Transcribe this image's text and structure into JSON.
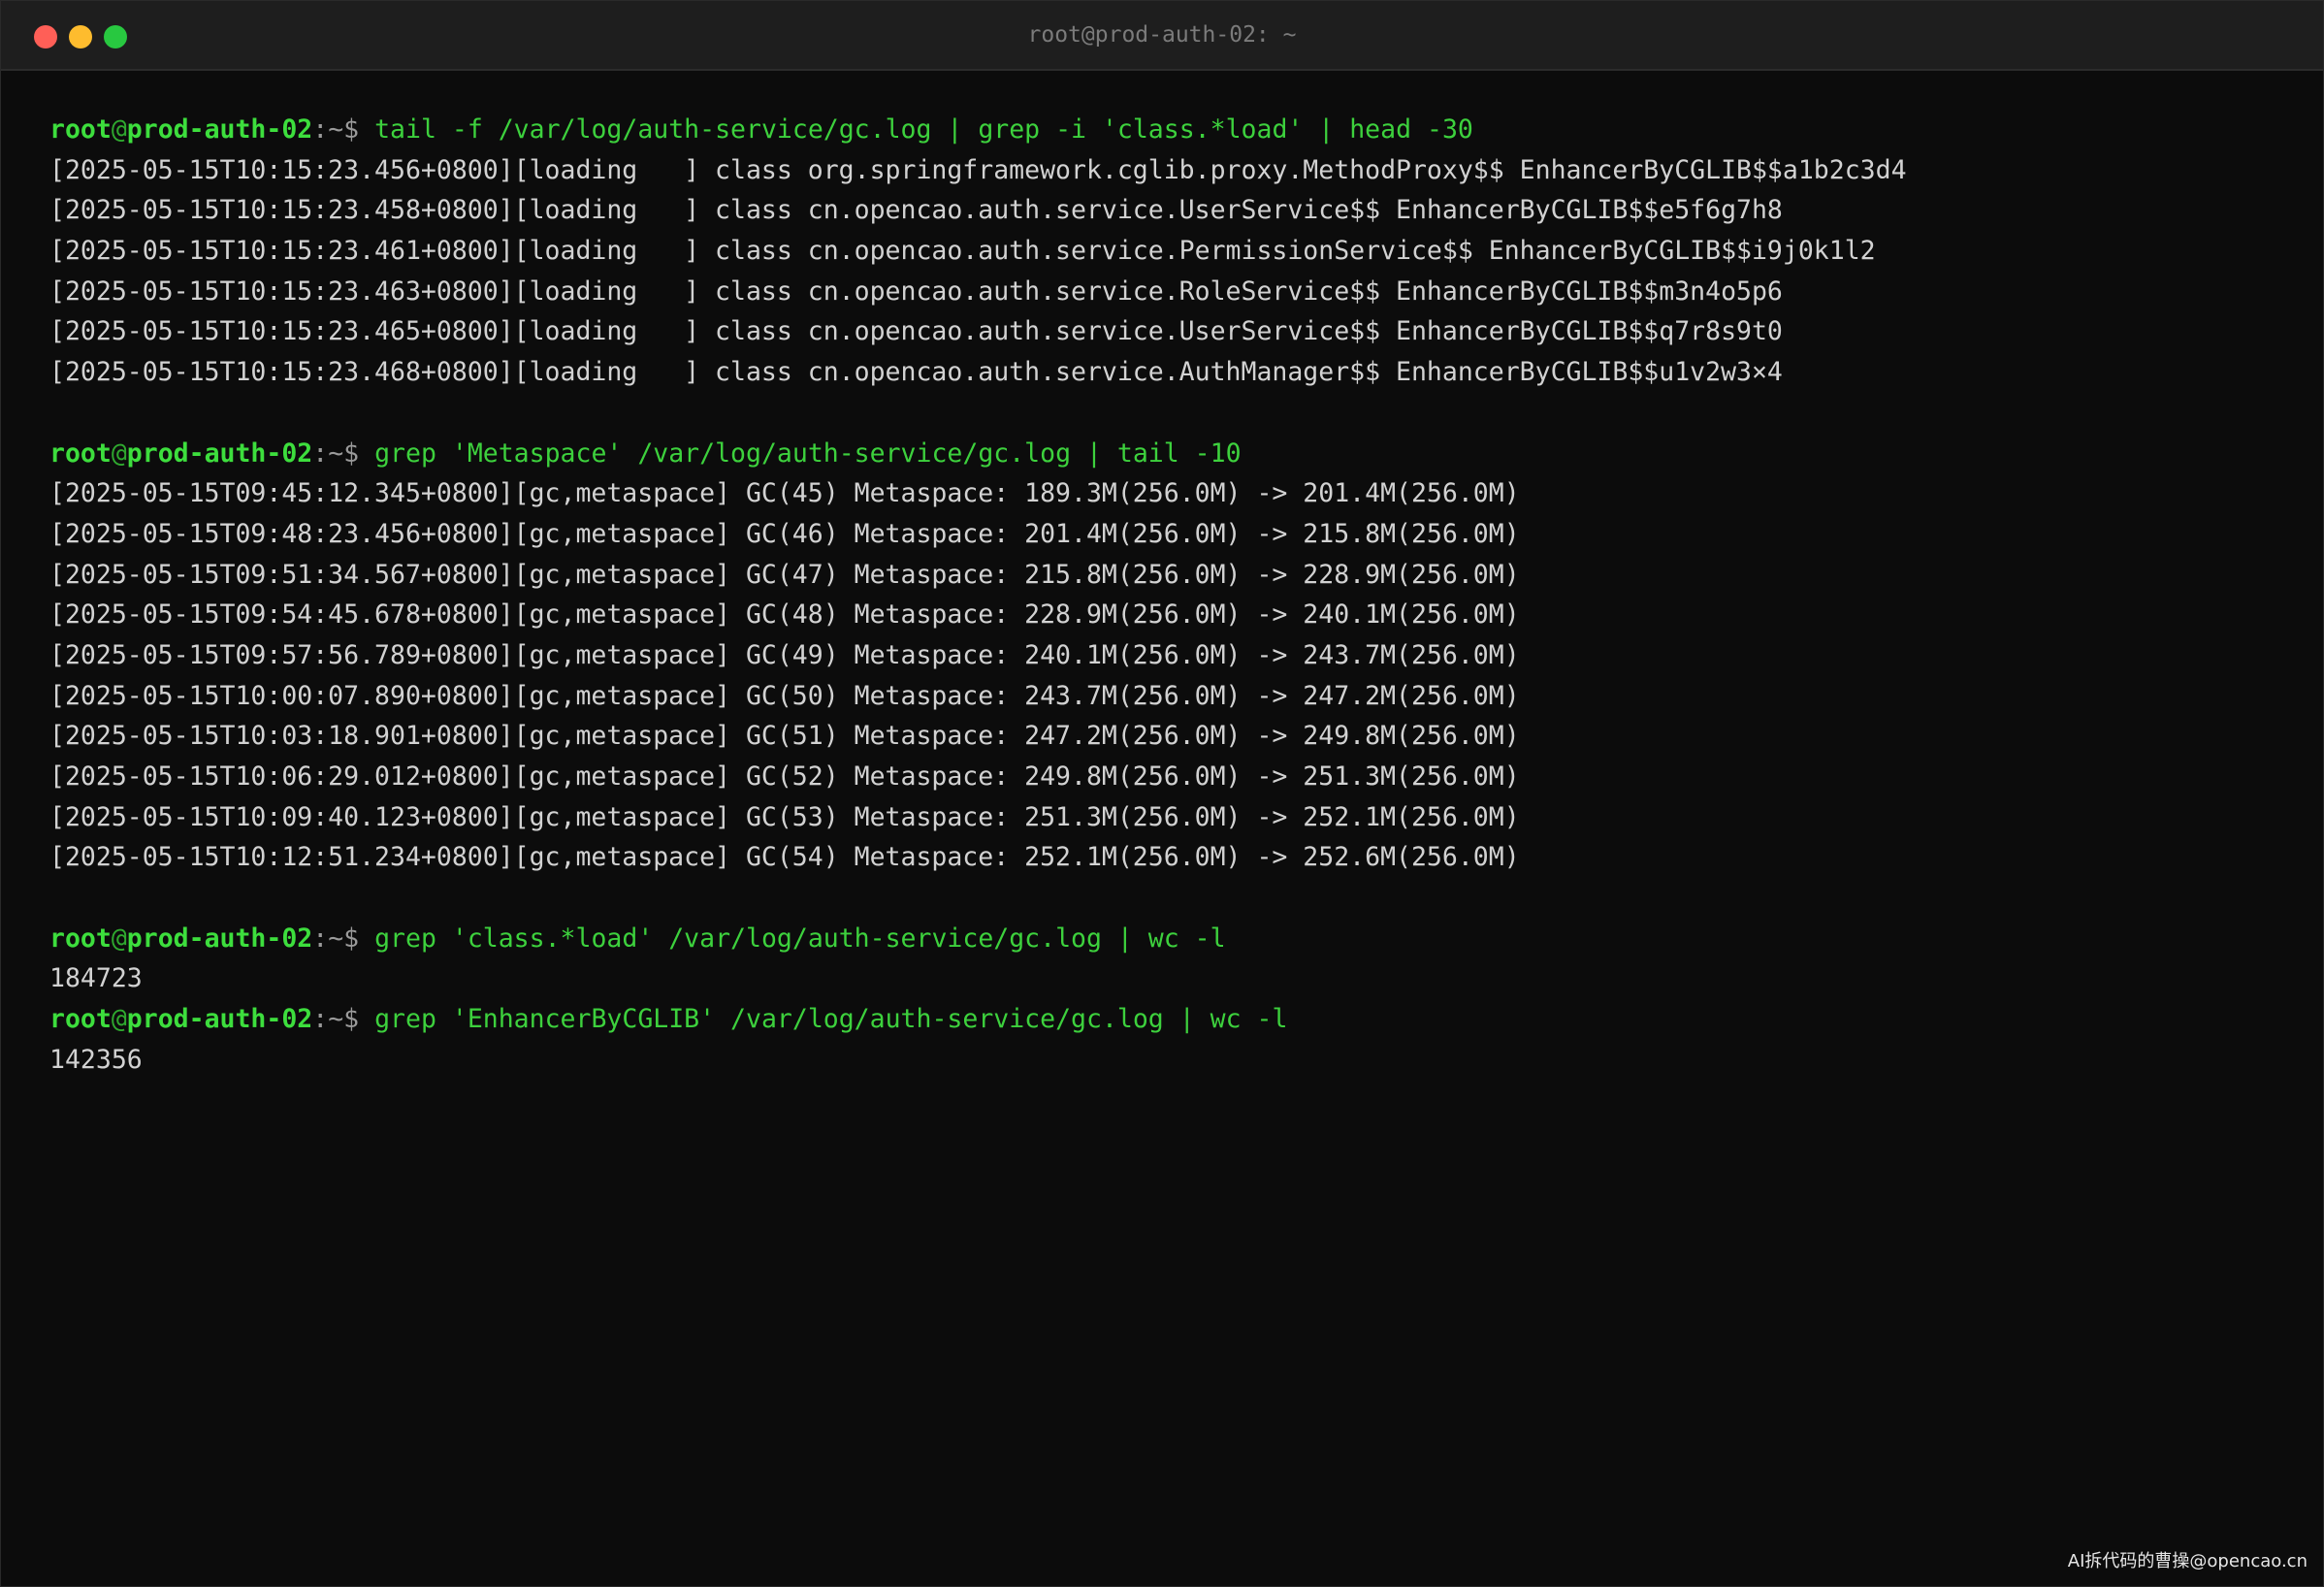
{
  "window": {
    "title": "root@prod-auth-02: ~"
  },
  "prompt": {
    "user": "root",
    "at": "@",
    "host": "prod-auth-02",
    "sep": ":~$"
  },
  "blocks": [
    {
      "command": "tail -f /var/log/auth-service/gc.log | grep -i 'class.*load' | head -30",
      "output": [
        "[2025-05-15T10:15:23.456+0800][loading   ] class org.springframework.cglib.proxy.MethodProxy$$ EnhancerByCGLIB$$a1b2c3d4",
        "[2025-05-15T10:15:23.458+0800][loading   ] class cn.opencao.auth.service.UserService$$ EnhancerByCGLIB$$e5f6g7h8",
        "[2025-05-15T10:15:23.461+0800][loading   ] class cn.opencao.auth.service.PermissionService$$ EnhancerByCGLIB$$i9j0k1l2",
        "[2025-05-15T10:15:23.463+0800][loading   ] class cn.opencao.auth.service.RoleService$$ EnhancerByCGLIB$$m3n4o5p6",
        "[2025-05-15T10:15:23.465+0800][loading   ] class cn.opencao.auth.service.UserService$$ EnhancerByCGLIB$$q7r8s9t0",
        "[2025-05-15T10:15:23.468+0800][loading   ] class cn.opencao.auth.service.AuthManager$$ EnhancerByCGLIB$$u1v2w3×4"
      ]
    },
    {
      "command": "grep 'Metaspace' /var/log/auth-service/gc.log | tail -10",
      "output": [
        "[2025-05-15T09:45:12.345+0800][gc,metaspace] GC(45) Metaspace: 189.3M(256.0M) -> 201.4M(256.0M)",
        "[2025-05-15T09:48:23.456+0800][gc,metaspace] GC(46) Metaspace: 201.4M(256.0M) -> 215.8M(256.0M)",
        "[2025-05-15T09:51:34.567+0800][gc,metaspace] GC(47) Metaspace: 215.8M(256.0M) -> 228.9M(256.0M)",
        "[2025-05-15T09:54:45.678+0800][gc,metaspace] GC(48) Metaspace: 228.9M(256.0M) -> 240.1M(256.0M)",
        "[2025-05-15T09:57:56.789+0800][gc,metaspace] GC(49) Metaspace: 240.1M(256.0M) -> 243.7M(256.0M)",
        "[2025-05-15T10:00:07.890+0800][gc,metaspace] GC(50) Metaspace: 243.7M(256.0M) -> 247.2M(256.0M)",
        "[2025-05-15T10:03:18.901+0800][gc,metaspace] GC(51) Metaspace: 247.2M(256.0M) -> 249.8M(256.0M)",
        "[2025-05-15T10:06:29.012+0800][gc,metaspace] GC(52) Metaspace: 249.8M(256.0M) -> 251.3M(256.0M)",
        "[2025-05-15T10:09:40.123+0800][gc,metaspace] GC(53) Metaspace: 251.3M(256.0M) -> 252.1M(256.0M)",
        "[2025-05-15T10:12:51.234+0800][gc,metaspace] GC(54) Metaspace: 252.1M(256.0M) -> 252.6M(256.0M)"
      ]
    },
    {
      "command": "grep 'class.*load' /var/log/auth-service/gc.log | wc -l",
      "output": [
        "184723"
      ]
    },
    {
      "command": "grep 'EnhancerByCGLIB' /var/log/auth-service/gc.log | wc -l",
      "output": [
        "142356"
      ]
    }
  ],
  "watermark": "AI拆代码的曹操@opencao.cn"
}
